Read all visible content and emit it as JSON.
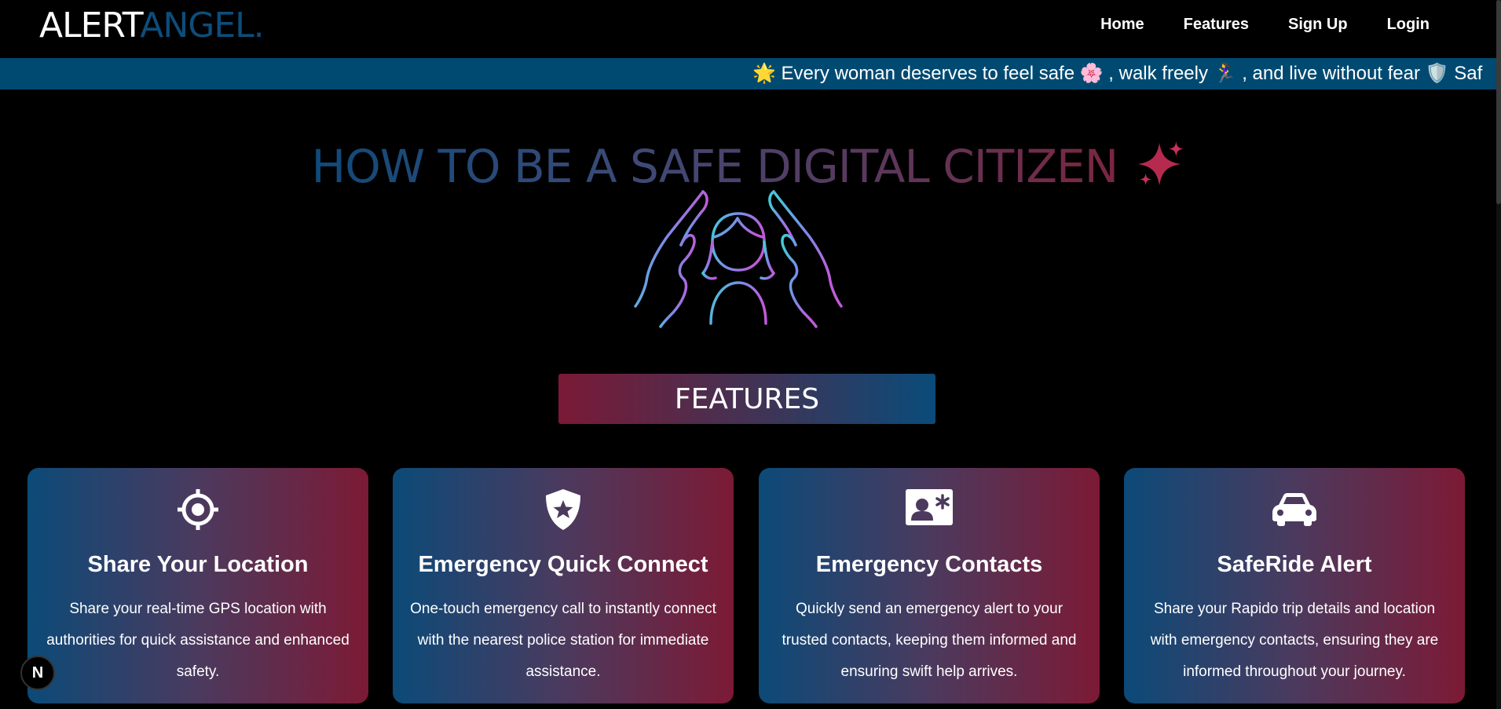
{
  "navbar": {
    "logo_part1": "ALERT",
    "logo_part2": "ANGEL.",
    "links": [
      "Home",
      "Features",
      "Sign Up",
      "Login"
    ]
  },
  "marquee": {
    "text": "🌟 Every woman deserves to feel safe 🌸 , walk freely 🏃‍♀️ , and live without fear 🛡️ Saf"
  },
  "hero": {
    "title": "HOW TO BE A SAFE DIGITAL CITIZEN"
  },
  "features_banner": "FEATURES",
  "cards": [
    {
      "icon": "target-icon",
      "title": "Share Your Location",
      "description": "Share your real-time GPS location with authorities for quick assistance and enhanced safety."
    },
    {
      "icon": "shield-star-icon",
      "title": "Emergency Quick Connect",
      "description": "One-touch emergency call to instantly connect with the nearest police station for immediate assistance."
    },
    {
      "icon": "contact-card-icon",
      "title": "Emergency Contacts",
      "description": "Quickly send an emergency alert to your trusted contacts, keeping them informed and ensuring swift help arrives."
    },
    {
      "icon": "car-icon",
      "title": "SafeRide Alert",
      "description": "Share your Rapido trip details and location with emergency contacts, ensuring they are informed throughout your journey."
    }
  ],
  "badge": "N",
  "colors": {
    "marquee_bg": "#004a72",
    "logo_accent": "#0d4d7a",
    "card_gradient_start": "#0c4a78",
    "card_gradient_end": "#7c1a35"
  }
}
